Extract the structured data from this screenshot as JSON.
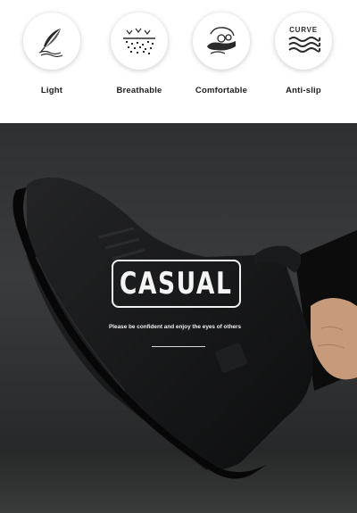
{
  "features": [
    {
      "label": "Light",
      "icon": "feather-icon"
    },
    {
      "label": "Breathable",
      "icon": "breathable-mesh-icon"
    },
    {
      "label": "Comfortable",
      "icon": "cushion-sole-icon"
    },
    {
      "label": "Anti-slip",
      "icon": "curve-tread-icon",
      "icon_text": "CURVE"
    }
  ],
  "hero": {
    "title": "CASUAL",
    "tagline": "Please be confident and enjoy the eyes of others"
  },
  "colors": {
    "background_dark": "#2f3031",
    "shoe": "#111213",
    "text_light": "#f4f4f4"
  }
}
